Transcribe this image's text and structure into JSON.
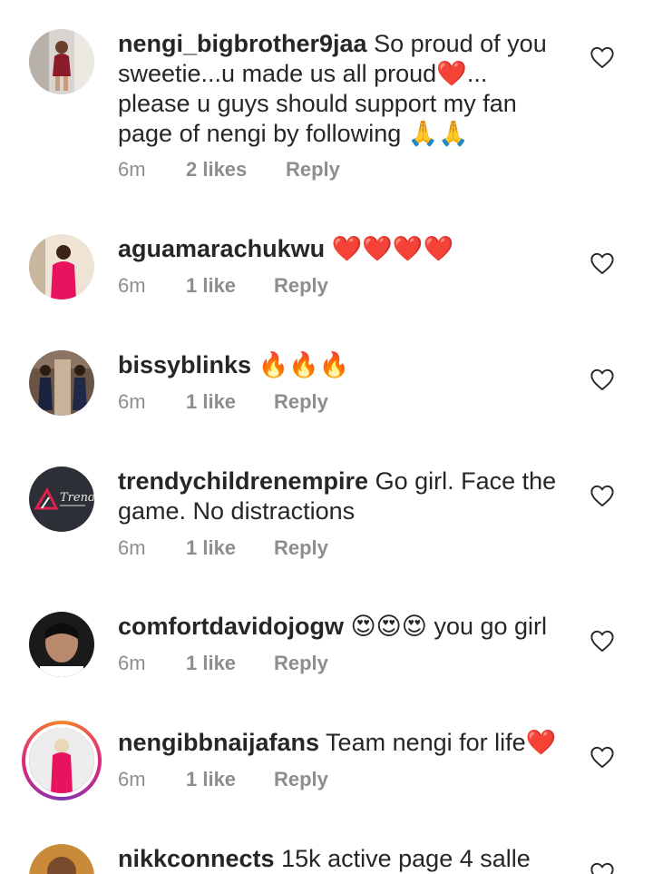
{
  "comments": [
    {
      "username": "nengi_bigbrother9jaa",
      "text": "So proud of you sweetie...u made us all proud❤️... please u guys should support my fan page of nengi by following 🙏🙏",
      "time": "6m",
      "likes": "2 likes",
      "reply": "Reply"
    },
    {
      "username": "aguamarachukwu",
      "text": "❤️❤️❤️❤️",
      "time": "6m",
      "likes": "1 like",
      "reply": "Reply"
    },
    {
      "username": "bissyblinks",
      "text": "🔥🔥🔥",
      "time": "6m",
      "likes": "1 like",
      "reply": "Reply"
    },
    {
      "username": "trendychildrenempire",
      "text": "Go girl. Face the game. No distractions",
      "time": "6m",
      "likes": "1 like",
      "reply": "Reply"
    },
    {
      "username": "comfortdavidojogw",
      "text": "😍😍😍 you go girl",
      "time": "6m",
      "likes": "1 like",
      "reply": "Reply"
    },
    {
      "username": "nengibbnaijafans",
      "text": "Team nengi for life❤️",
      "time": "6m",
      "likes": "1 like",
      "reply": "Reply"
    },
    {
      "username": "nikkconnects",
      "text": "15k active page 4 salle",
      "time": "",
      "likes": "",
      "reply": ""
    }
  ],
  "avatar_brand_text": "Trendy",
  "icons": {
    "like": "heart-outline-icon"
  },
  "colors": {
    "text": "#262626",
    "meta": "#8e8e8e",
    "heart": "#e0111d"
  }
}
